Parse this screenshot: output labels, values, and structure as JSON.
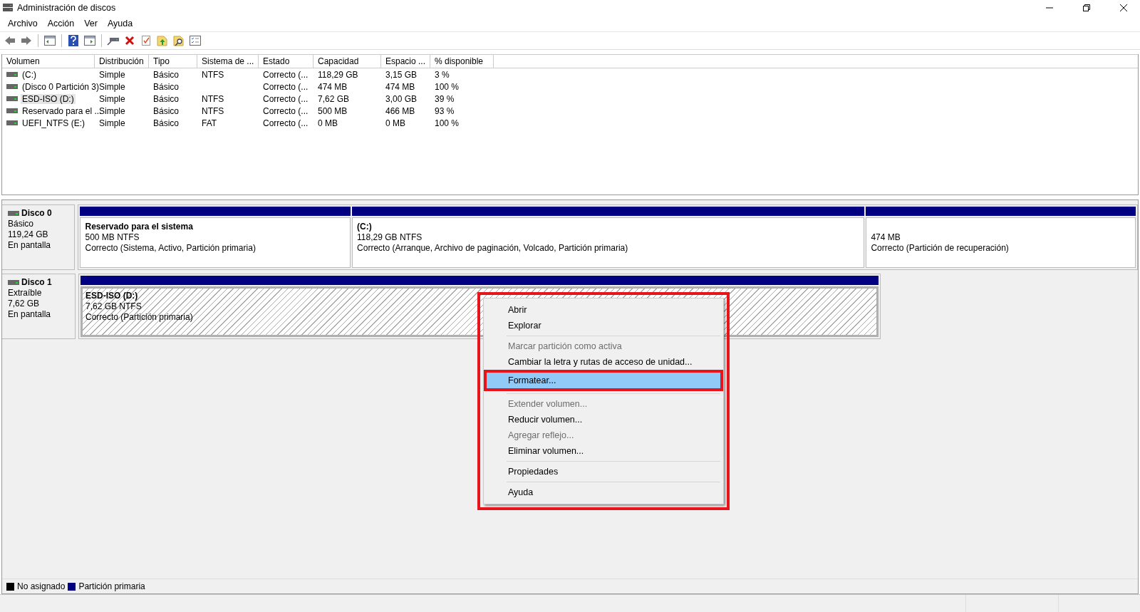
{
  "window": {
    "title": "Administración de discos"
  },
  "menu": [
    "Archivo",
    "Acción",
    "Ver",
    "Ayuda"
  ],
  "toolbar": [
    {
      "kind": "back"
    },
    {
      "kind": "forward"
    },
    {
      "kind": "sep"
    },
    {
      "kind": "pane"
    },
    {
      "kind": "sep"
    },
    {
      "kind": "help"
    },
    {
      "kind": "pane2"
    },
    {
      "kind": "sep"
    },
    {
      "kind": "connect"
    },
    {
      "kind": "delete"
    },
    {
      "kind": "check"
    },
    {
      "kind": "folderup"
    },
    {
      "kind": "foldersearch"
    },
    {
      "kind": "list"
    }
  ],
  "table": {
    "columns": [
      "Volumen",
      "Distribución",
      "Tipo",
      "Sistema de ...",
      "Estado",
      "Capacidad",
      "Espacio ...",
      "% disponible"
    ],
    "rows": [
      {
        "selected": false,
        "cells": [
          " (C:)",
          "Simple",
          "Básico",
          "NTFS",
          "Correcto (...",
          "118,29 GB",
          "3,15 GB",
          "3 %"
        ]
      },
      {
        "selected": false,
        "cells": [
          "(Disco 0 Partición 3)",
          "Simple",
          "Básico",
          "",
          "Correcto (...",
          "474 MB",
          "474 MB",
          "100 %"
        ]
      },
      {
        "selected": true,
        "cells": [
          "ESD-ISO (D:)",
          "Simple",
          "Básico",
          "NTFS",
          "Correcto (...",
          "7,62 GB",
          "3,00 GB",
          "39 %"
        ]
      },
      {
        "selected": false,
        "cells": [
          "Reservado para el ...",
          "Simple",
          "Básico",
          "NTFS",
          "Correcto (...",
          "500 MB",
          "466 MB",
          "93 %"
        ]
      },
      {
        "selected": false,
        "cells": [
          "UEFI_NTFS (E:)",
          "Simple",
          "Básico",
          "FAT",
          "Correcto (...",
          "0 MB",
          "0 MB",
          "100 %"
        ]
      }
    ]
  },
  "disks": [
    {
      "name": "Disco 0",
      "type": "Básico",
      "size": "119,24 GB",
      "status": "En pantalla",
      "partitions": [
        {
          "selected": false,
          "name": "Reservado para el sistema",
          "size": "500 MB NTFS",
          "status": "Correcto (Sistema, Activo, Partición primaria)"
        },
        {
          "selected": false,
          "name": "(C:)",
          "size": "118,29 GB NTFS",
          "status": "Correcto (Arranque, Archivo de paginación, Volcado, Partición primaria)"
        },
        {
          "selected": false,
          "size": "474 MB",
          "status": "Correcto (Partición de recuperación)"
        }
      ]
    },
    {
      "name": "Disco 1",
      "type": "Extraíble",
      "size": "7,62 GB",
      "status": "En pantalla",
      "partitions": [
        {
          "selected": true,
          "name": "ESD-ISO  (D:)",
          "size": "7,62 GB NTFS",
          "status": "Correcto (Partición primaria)"
        }
      ]
    }
  ],
  "context_menu": {
    "items": [
      {
        "kind": "item",
        "label": "Abrir",
        "disabled": false,
        "selected": false
      },
      {
        "kind": "item",
        "label": "Explorar",
        "disabled": false,
        "selected": false
      },
      {
        "kind": "separator"
      },
      {
        "kind": "item",
        "label": "Marcar partición como activa",
        "disabled": true,
        "selected": false
      },
      {
        "kind": "item",
        "label": "Cambiar la letra y rutas de acceso de unidad...",
        "disabled": false,
        "selected": false
      },
      {
        "kind": "item",
        "label": "Formatear...",
        "disabled": false,
        "selected": true
      },
      {
        "kind": "separator"
      },
      {
        "kind": "item",
        "label": "Extender volumen...",
        "disabled": true,
        "selected": false
      },
      {
        "kind": "item",
        "label": "Reducir volumen...",
        "disabled": false,
        "selected": false
      },
      {
        "kind": "item",
        "label": "Agregar reflejo...",
        "disabled": true,
        "selected": false
      },
      {
        "kind": "item",
        "label": "Eliminar volumen...",
        "disabled": false,
        "selected": false
      },
      {
        "kind": "separator"
      },
      {
        "kind": "item",
        "label": "Propiedades",
        "disabled": false,
        "selected": false
      },
      {
        "kind": "separator"
      },
      {
        "kind": "item",
        "label": "Ayuda",
        "disabled": false,
        "selected": false
      }
    ]
  },
  "legend": [
    {
      "label": "No asignado",
      "color": "#000000"
    },
    {
      "label": "Partición primaria",
      "color": "#000080"
    }
  ]
}
